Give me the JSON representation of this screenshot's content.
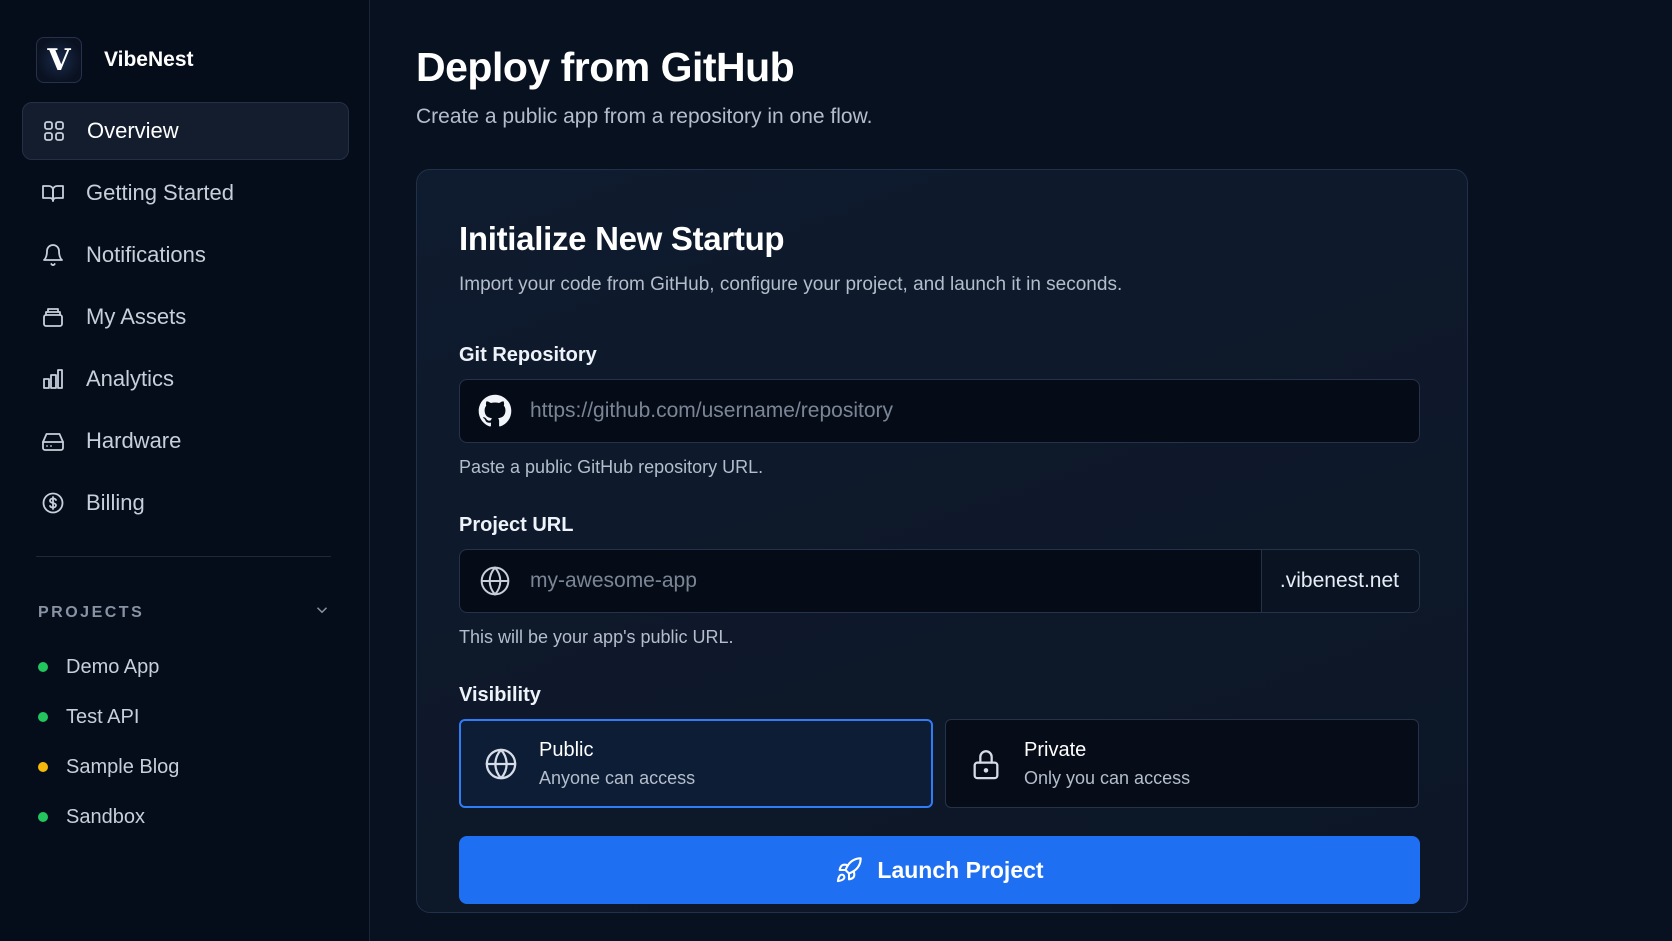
{
  "brand": {
    "logo_letter": "V",
    "name": "VibeNest"
  },
  "sidebar": {
    "nav": [
      {
        "label": "Overview",
        "icon": "grid-icon",
        "active": true
      },
      {
        "label": "Getting Started",
        "icon": "book-icon"
      },
      {
        "label": "Notifications",
        "icon": "bell-icon"
      },
      {
        "label": "My Assets",
        "icon": "stack-icon"
      },
      {
        "label": "Analytics",
        "icon": "bar-chart-icon"
      },
      {
        "label": "Hardware",
        "icon": "hard-drive-icon"
      },
      {
        "label": "Billing",
        "icon": "dollar-circle-icon"
      }
    ],
    "projects_heading": "PROJECTS",
    "projects": [
      {
        "name": "Demo App",
        "status_color": "#22c55e"
      },
      {
        "name": "Test API",
        "status_color": "#22c55e"
      },
      {
        "name": "Sample Blog",
        "status_color": "#f5b80b"
      },
      {
        "name": "Sandbox",
        "status_color": "#22c55e"
      }
    ]
  },
  "main": {
    "title": "Deploy from GitHub",
    "subtitle": "Create a public app from a repository in one flow."
  },
  "card": {
    "title": "Initialize New Startup",
    "subtitle": "Import your code from GitHub, configure your project, and launch it in seconds.",
    "repo": {
      "label": "Git Repository",
      "placeholder": "https://github.com/username/repository",
      "value": "",
      "helper": "Paste a public GitHub repository URL."
    },
    "project_url": {
      "label": "Project URL",
      "placeholder": "my-awesome-app",
      "value": "",
      "suffix": ".vibenest.net",
      "helper": "This will be your app's public URL."
    },
    "visibility": {
      "label": "Visibility",
      "options": [
        {
          "title": "Public",
          "description": "Anyone can access",
          "icon": "globe-icon",
          "selected": true
        },
        {
          "title": "Private",
          "description": "Only you can access",
          "icon": "lock-icon",
          "selected": false
        }
      ]
    },
    "launch_label": "Launch Project"
  },
  "colors": {
    "accent": "#1f6ff2",
    "selected_border": "#2f7cf6",
    "background": "#071120",
    "status_green": "#22c55e",
    "status_yellow": "#f5b80b"
  }
}
